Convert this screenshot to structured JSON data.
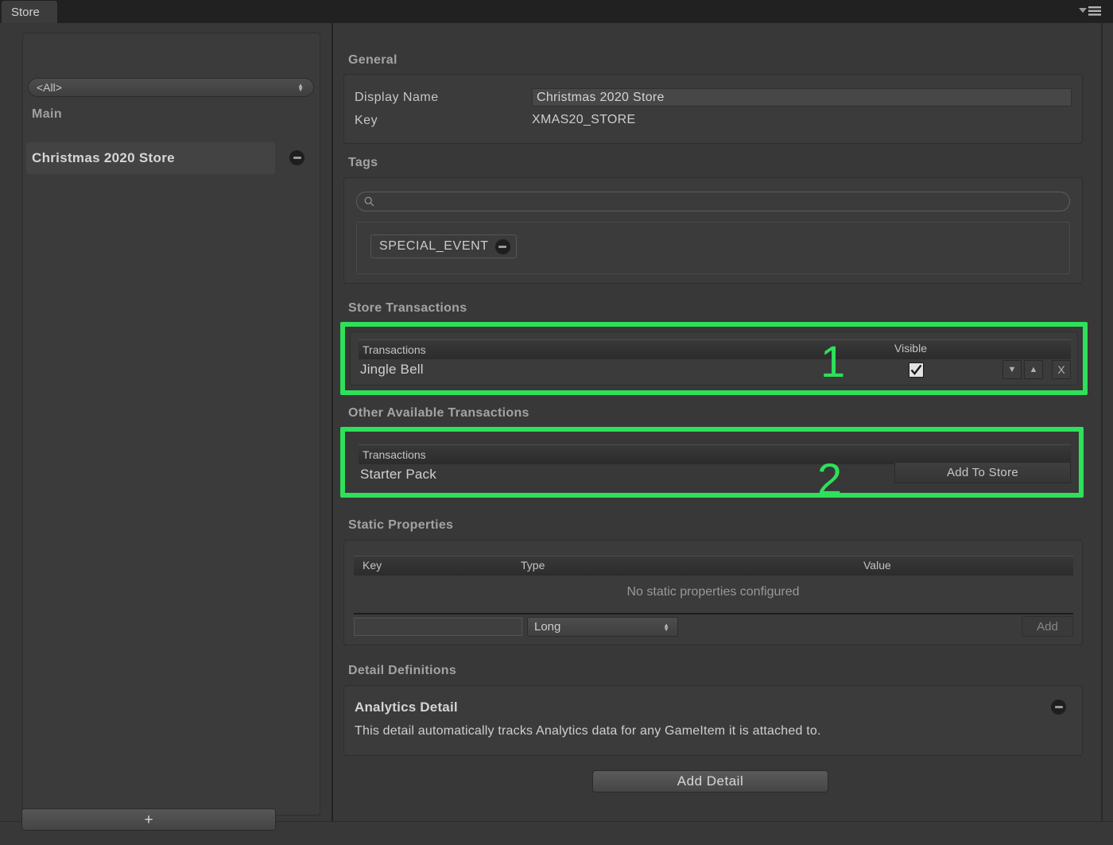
{
  "window": {
    "tab_label": "Store",
    "menu_icon": "hamburger-menu-icon"
  },
  "sidebar": {
    "filter": {
      "selected": "<All>",
      "options": [
        "<All>"
      ]
    },
    "group_label": "Main",
    "items": [
      {
        "label": "Christmas 2020 Store",
        "remove_icon": "minus-circle-icon"
      }
    ],
    "add_button_label": "+"
  },
  "general": {
    "title": "General",
    "display_name_label": "Display Name",
    "display_name_value": "Christmas 2020 Store",
    "display_name_placeholder": "",
    "key_label": "Key",
    "key_value": "XMAS20_STORE"
  },
  "tags": {
    "title": "Tags",
    "search_placeholder": "",
    "search_value": "",
    "search_icon": "search-icon",
    "chips": [
      {
        "label": "SPECIAL_EVENT",
        "remove_icon": "minus-circle-icon"
      }
    ]
  },
  "store_transactions": {
    "title": "Store Transactions",
    "column_transactions": "Transactions",
    "column_visible": "Visible",
    "rows": [
      {
        "name": "Jingle Bell",
        "visible": true,
        "move_down_label": "▼",
        "move_up_label": "▲",
        "remove_label": "X"
      }
    ]
  },
  "other_transactions": {
    "title": "Other Available Transactions",
    "column_transactions": "Transactions",
    "rows": [
      {
        "name": "Starter Pack",
        "action_label": "Add To Store"
      }
    ]
  },
  "static_properties": {
    "title": "Static Properties",
    "columns": [
      "Key",
      "Type",
      "Value"
    ],
    "empty_message": "No static properties configured",
    "new_key_value": "",
    "new_key_placeholder": "",
    "new_type_selected": "Long",
    "new_type_options": [
      "Long"
    ],
    "add_label": "Add"
  },
  "detail_definitions": {
    "title": "Detail Definitions",
    "details": [
      {
        "name": "Analytics Detail",
        "description": "This detail automatically tracks Analytics data for any GameItem it is attached to.",
        "remove_icon": "minus-circle-icon"
      }
    ],
    "add_detail_label": "Add Detail"
  },
  "annotations": {
    "highlight_color": "#2ee05a",
    "markers": [
      {
        "label": "1",
        "target": "store-transactions"
      },
      {
        "label": "2",
        "target": "other-available-transactions"
      }
    ]
  }
}
